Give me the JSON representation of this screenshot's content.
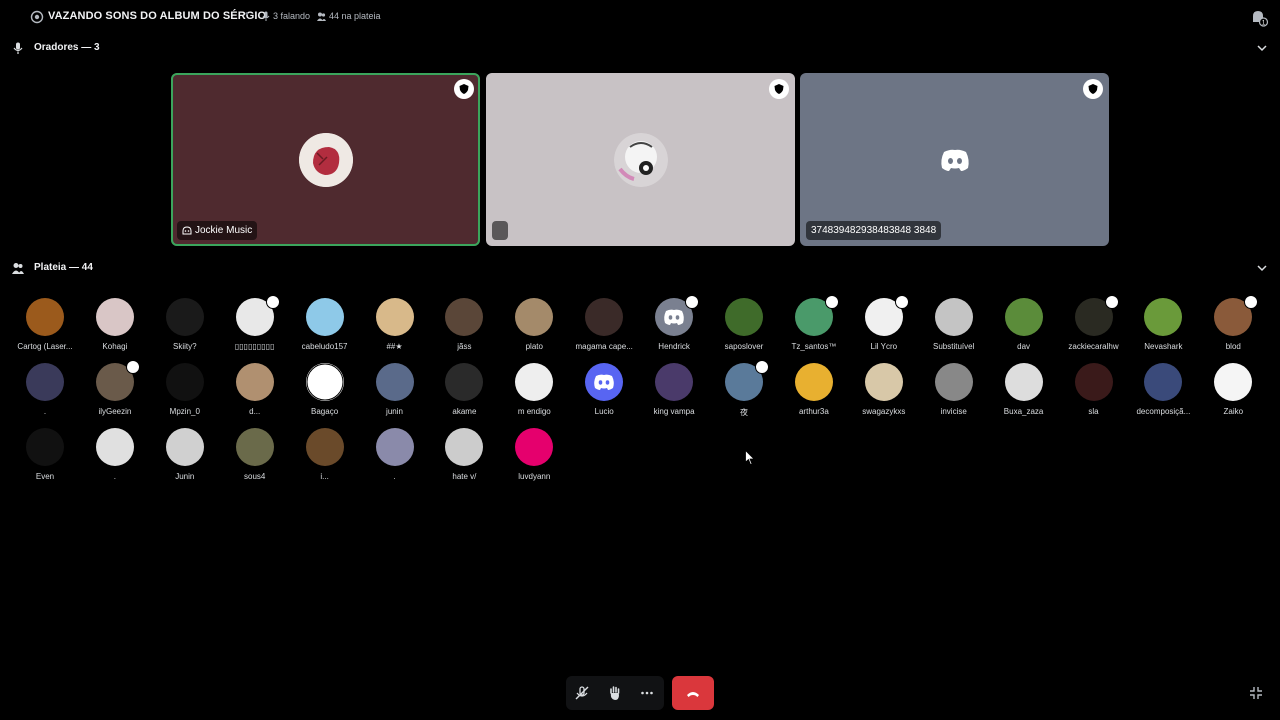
{
  "topbar": {
    "title": "VAZANDO SONS DO ALBUM DO SÉRGIO",
    "separator": "•",
    "speaking": "3 falando",
    "audience_count": "44 na plateia"
  },
  "speakers_section": {
    "label": "Oradores — 3",
    "tiles": [
      {
        "name": "Jockie Music",
        "bg": "#4f2a2f",
        "avatar_color": "#b03a48",
        "active": true
      },
      {
        "name": "",
        "bg": "#c8c2c5",
        "avatar_color": "#eeeeee",
        "active": false
      },
      {
        "name": "374839482938483848 3848",
        "bg": "#6d7585",
        "avatar_color": "#6d7585",
        "active": false
      }
    ]
  },
  "audience_section": {
    "label": "Plateia — 44",
    "members": [
      {
        "name": "Cartog (Laser...",
        "color": "#9b5a1c",
        "badge": false
      },
      {
        "name": "Kohagi",
        "color": "#d9c6c6",
        "badge": false
      },
      {
        "name": "Skiity?",
        "color": "#1a1a1a",
        "badge": false
      },
      {
        "name": "▯▯▯▯▯▯▯▯▯",
        "color": "#e8e8e8",
        "badge": true
      },
      {
        "name": "cabeludo157",
        "color": "#8ec9e8",
        "badge": false
      },
      {
        "name": "##★",
        "color": "#d8b98a",
        "badge": false
      },
      {
        "name": "jãss",
        "color": "#5a4638",
        "badge": false
      },
      {
        "name": "plato",
        "color": "#a48a6a",
        "badge": false
      },
      {
        "name": "magama cape...",
        "color": "#3a2a28",
        "badge": false
      },
      {
        "name": "Hendrick",
        "color": "#7a8090",
        "badge": true
      },
      {
        "name": "saposlover",
        "color": "#3f6b2a",
        "badge": false
      },
      {
        "name": "Tz_santos™",
        "color": "#4a9a6a",
        "badge": true
      },
      {
        "name": "Lil Ycro",
        "color": "#f0f0f0",
        "badge": true
      },
      {
        "name": "Substituível",
        "color": "#c4c4c4",
        "badge": false
      },
      {
        "name": "dav",
        "color": "#5b8c3a",
        "badge": false
      },
      {
        "name": "zackiecaralhw",
        "color": "#2a2a22",
        "badge": true
      },
      {
        "name": "Nevashark",
        "color": "#6a9a3a",
        "badge": false
      },
      {
        "name": "blod",
        "color": "#8a5a3a",
        "badge": true
      },
      {
        "name": ".",
        "color": "#3a3a5a",
        "badge": false
      },
      {
        "name": "ilyGeezin",
        "color": "#6a5a4a",
        "badge": true
      },
      {
        "name": "Mpzin_0",
        "color": "#111111",
        "badge": false
      },
      {
        "name": "d...",
        "color": "#b09070",
        "badge": false
      },
      {
        "name": "Bagaço",
        "color": "#ffffff",
        "badge": false
      },
      {
        "name": "junin",
        "color": "#5a6a8a",
        "badge": false
      },
      {
        "name": "akame",
        "color": "#2a2a2a",
        "badge": false
      },
      {
        "name": "m endigo",
        "color": "#eeeeee",
        "badge": false
      },
      {
        "name": "Lucio",
        "color": "#5865f2",
        "badge": false
      },
      {
        "name": "king vampa",
        "color": "#4a3a6a",
        "badge": false
      },
      {
        "name": "夜",
        "color": "#5a7a9a",
        "badge": true
      },
      {
        "name": "arthur3a",
        "color": "#e8b030",
        "badge": false
      },
      {
        "name": "swagazykxs",
        "color": "#d8c8a8",
        "badge": false
      },
      {
        "name": "invicise",
        "color": "#888888",
        "badge": false
      },
      {
        "name": "Buxa_zaza",
        "color": "#dddddd",
        "badge": false
      },
      {
        "name": "sla",
        "color": "#3a1a1a",
        "badge": false
      },
      {
        "name": "decomposiçã...",
        "color": "#3a4a7a",
        "badge": false
      },
      {
        "name": "Zaiko",
        "color": "#f5f5f5",
        "badge": false
      },
      {
        "name": "Even",
        "color": "#111111",
        "badge": false
      },
      {
        "name": ".",
        "color": "#e0e0e0",
        "badge": false
      },
      {
        "name": "Junin",
        "color": "#d0d0d0",
        "badge": false
      },
      {
        "name": "sous4",
        "color": "#6a6a4a",
        "badge": false
      },
      {
        "name": "i...",
        "color": "#6a4a2a",
        "badge": false
      },
      {
        "name": ".",
        "color": "#8a8aaa",
        "badge": false
      },
      {
        "name": "hate v/",
        "color": "#cccccc",
        "badge": false
      },
      {
        "name": "luvdyann",
        "color": "#e5006d",
        "badge": false
      }
    ]
  },
  "icons": {
    "stage": "stage-channel-icon",
    "mic": "microphone-icon",
    "audience": "audience-icon",
    "inbox": "inbox-icon",
    "chevron": "chevron-down-icon",
    "moderator": "moderator-shield-icon",
    "discord": "discord-logo-icon",
    "mute": "mic-muted-icon",
    "hand": "raise-hand-icon",
    "more": "more-icon",
    "leave": "leave-call-icon",
    "fullscreen": "exit-fullscreen-icon"
  },
  "colors": {
    "background": "#000000",
    "accent_green": "#3ba55c",
    "leave_red": "#da373c",
    "discord_blurple": "#5865f2"
  }
}
